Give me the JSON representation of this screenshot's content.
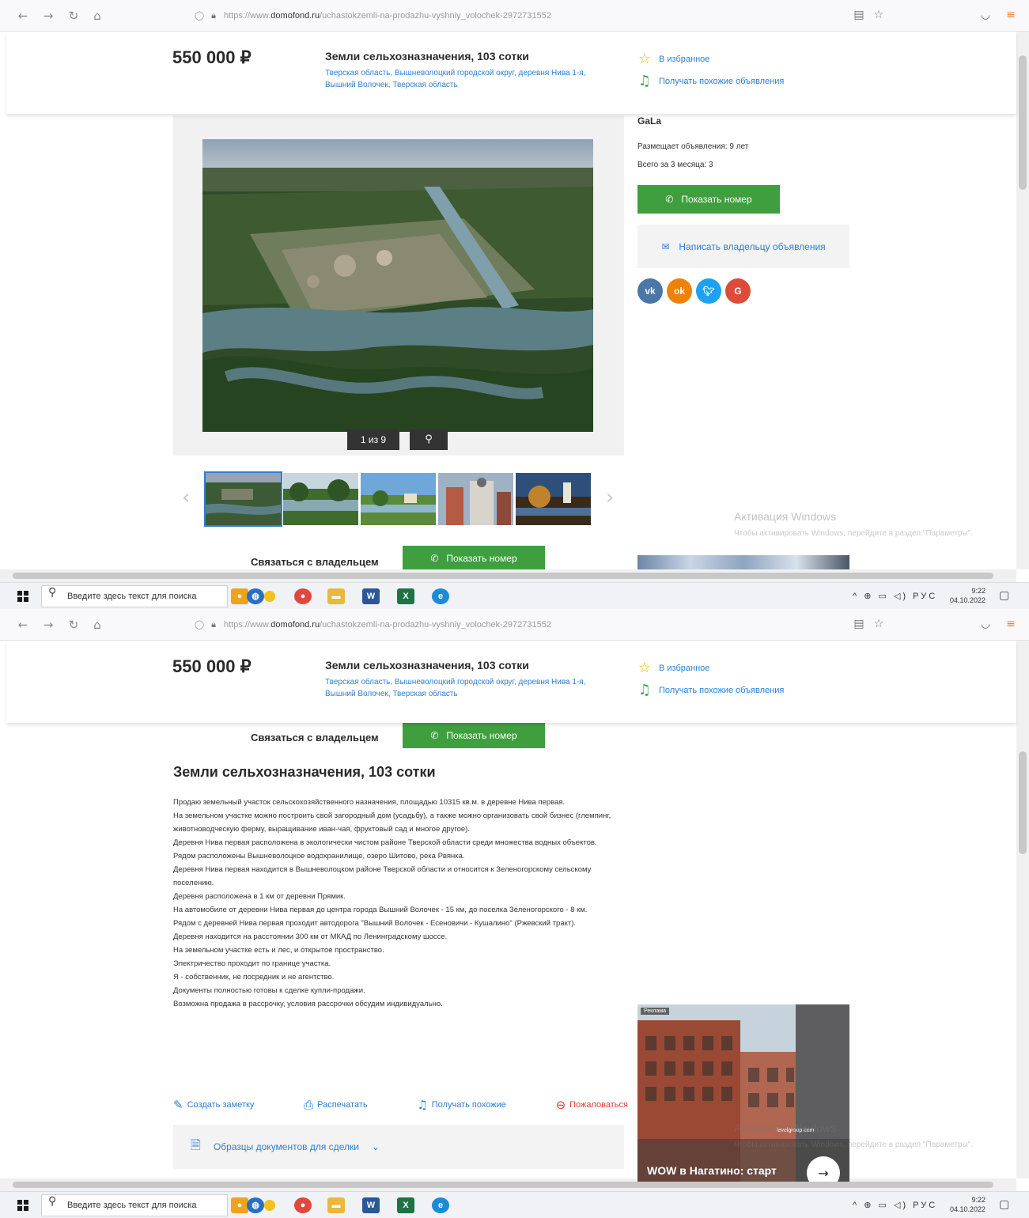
{
  "browser": {
    "url_prefix": "https://www.",
    "url_domain": "domofond.ru",
    "url_path": "/uchastokzemli-na-prodazhu-vyshniy_volochek-2972731552"
  },
  "header": {
    "price": "550 000 ₽",
    "title": "Земли сельхозназначения, 103 сотки",
    "address": "Тверская область, Вышневолоцкий городской округ, деревня Нива 1-я, Вышний Волочек, Тверская область",
    "favorite_label": "В избранное",
    "similar_label": "Получать похожие объявления"
  },
  "gallery": {
    "counter": "1 из 9",
    "thumb_count": 5
  },
  "seller": {
    "name": "GaLa",
    "posting_since": "Размещает объявления: 9 лет",
    "total_3_months": "Всего за 3 месяца: 3",
    "show_phone_label": "Показать номер",
    "write_owner_label": "Написать владельцу объявления",
    "socials": [
      {
        "label": "vk",
        "color": "#4a76a8"
      },
      {
        "label": "ok",
        "color": "#ee8208"
      },
      {
        "label": "tw",
        "color": "#1da1f2"
      },
      {
        "label": "G",
        "color": "#dd4b39"
      }
    ]
  },
  "contact": {
    "label": "Связаться с владельцем",
    "button_label": "Показать номер"
  },
  "windows": {
    "activate_title": "Активация Windows",
    "activate_text": "Чтобы активировать Windows, перейдите в раздел \"Параметры\"."
  },
  "taskbar": {
    "search_placeholder": "Введите здесь текст для поиска",
    "lang": "РУС",
    "time": "9:22",
    "date": "04.10.2022"
  },
  "description": {
    "title": "Земли сельхозназначения, 103 сотки",
    "lines": [
      "Продаю земельный участок сельскохозяйственного назначения, площадью 10315 кв.м. в деревне Нива первая.",
      "На земельном участке можно построить свой загородный дом (усадьбу), а также можно организовать свой бизнес (глемпинг, животноводческую ферму, выращивание иван-чая, фруктовый сад и многое другое).",
      "Деревня Нива первая расположена в экологически чистом районе Тверской области среди множества водных объектов.",
      "Рядом расположены Вышневолоцкое водохранилище, озеро Шитово, река Рвянка.",
      "Деревня Нива первая находится в Вышневолоцком районе Тверской области и относится к Зеленогорскому сельскому поселению.",
      "Деревня расположена в 1 км от деревни Прямик.",
      "На автомобиле от деревни Нива первая до центра города Вышний Волочек - 15 км, до поселка Зеленогорского - 8 км.",
      "Рядом с деревней Нива первая проходит автодорога \"Вышний Волочек - Есеновичи - Кушалино\" (Ржевский тракт).",
      "Деревня находится на расстоянии 300 км от МКАД по Ленинградскому шоссе.",
      "На земельном участке есть и лес, и открытое пространство.",
      "Электричество проходит по границе участка.",
      "Я - собственник, не посредник и не агентство.",
      "Документы полностью готовы к сделке купли-продажи.",
      "Возможна продажа в рассрочку, условия рассрочки обсудим индивидуально."
    ],
    "actions": {
      "note": "Создать заметку",
      "print": "Распечатать",
      "similar": "Получать похожие",
      "complain": "Пожаловаться"
    },
    "docs_label": "Образцы документов для сделки"
  },
  "ad": {
    "badge": "Реклама",
    "caption": "WOW в Нагатино: старт",
    "site": "levelgroup.com"
  }
}
